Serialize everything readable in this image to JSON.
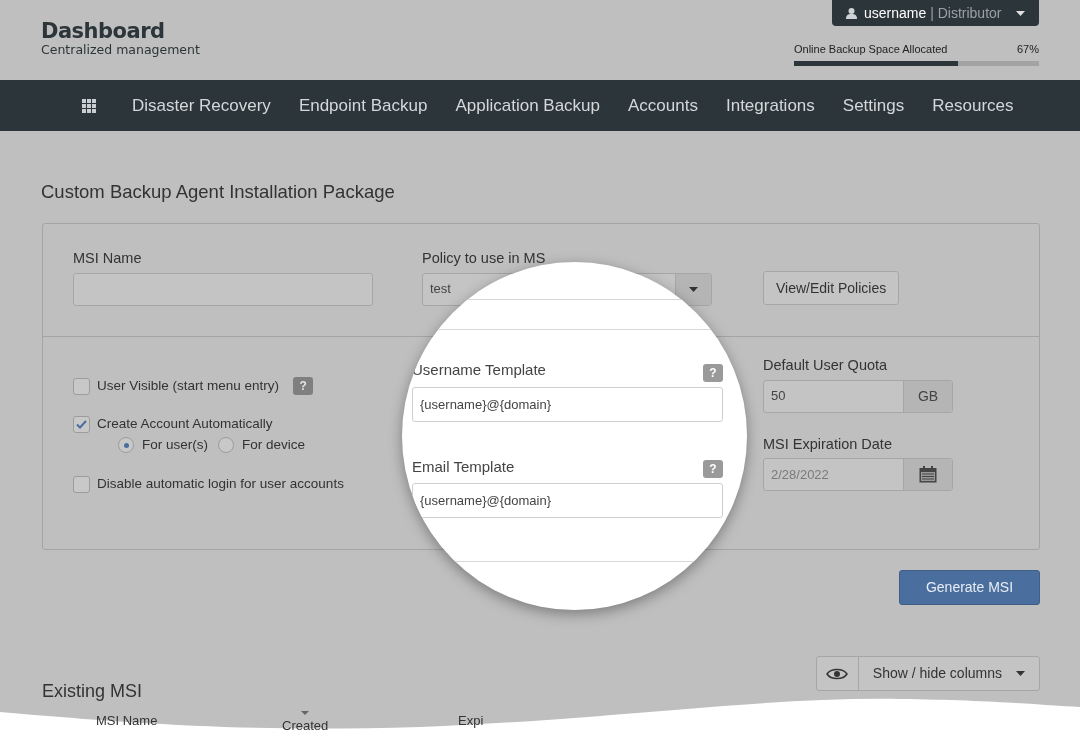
{
  "header": {
    "title": "Dashboard",
    "subtitle": "Centralized management",
    "user": {
      "name": "username",
      "separator": "|",
      "role": "Distributor"
    },
    "storage": {
      "label": "Online Backup Space Allocated",
      "reading": "67%",
      "level": 0.67
    }
  },
  "nav": [
    "Disaster Recovery",
    "Endpoint Backup",
    "Application Backup",
    "Accounts",
    "Integrations",
    "Settings",
    "Resources"
  ],
  "page_title": "Custom Backup Agent Installation Package",
  "form": {
    "msi_name": {
      "label": "MSI Name"
    },
    "policy": {
      "label": "Policy to use in MS",
      "value": "test"
    },
    "policies_button": "View/Edit Policies",
    "options": [
      {
        "label": "User Visible (start menu entry)",
        "checked": false,
        "help": "?"
      },
      {
        "label": "Create Account Automatically",
        "checked": true,
        "choices": [
          {
            "label": "For user(s)",
            "selected": true
          },
          {
            "label": "For device",
            "selected": false
          }
        ]
      },
      {
        "label": "Disable automatic login for user accounts",
        "checked": false
      }
    ],
    "quota": {
      "label": "Default User Quota",
      "value": "50",
      "unit": "GB"
    },
    "expiration": {
      "label": "MSI Expiration Date",
      "placeholder": "2/28/2022"
    }
  },
  "magnifier": {
    "fields": [
      {
        "label": "Username Template",
        "help": "?",
        "value": "{username}@{domain}"
      },
      {
        "label": "Email Template",
        "help": "?",
        "value": "{username}@{domain}"
      }
    ]
  },
  "generate_button": "Generate MSI",
  "existing": {
    "title": "Existing MSI",
    "columns_button": "Show / hide columns",
    "columns": [
      {
        "label": "MSI Name",
        "sorted": false
      },
      {
        "label": "Created",
        "sorted": true
      },
      {
        "label": "Expi",
        "sorted": false
      }
    ]
  }
}
